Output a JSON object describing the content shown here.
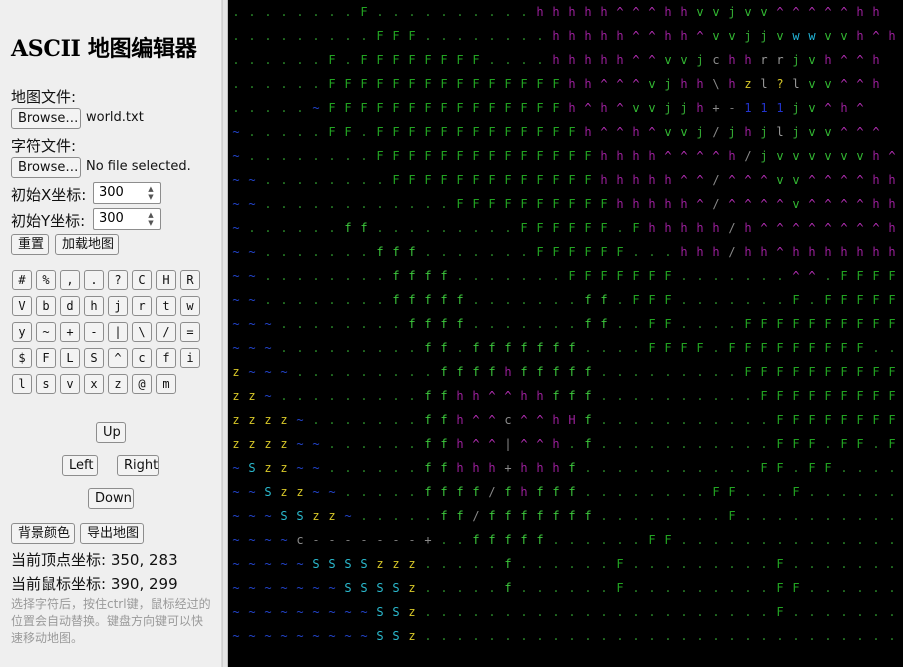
{
  "sidebar": {
    "title": "ASCII 地图编辑器",
    "map_file_label": "地图文件:",
    "map_browse": "Browse…",
    "map_file_name": "world.txt",
    "char_file_label": "字符文件:",
    "char_browse": "Browse…",
    "char_file_name": "No file selected.",
    "start_x_label": "初始X坐标:",
    "start_x_value": "300",
    "start_y_label": "初始Y坐标:",
    "start_y_value": "300",
    "reset_button": "重置",
    "load_button": "加载地图",
    "char_buttons": [
      "#",
      "%",
      ",",
      ".",
      "?",
      "C",
      "H",
      "R",
      "V",
      "b",
      "d",
      "h",
      "j",
      "r",
      "t",
      "w",
      "y",
      "~",
      "+",
      "-",
      "|",
      "\\",
      "/",
      "=",
      "$",
      "F",
      "L",
      "S",
      "^",
      "c",
      "f",
      "i",
      "l",
      "s",
      "v",
      "x",
      "z",
      "@",
      "m"
    ],
    "nav": {
      "up": "Up",
      "left": "Left",
      "right": "Right",
      "down": "Down"
    },
    "bg_color_button": "背景颜色",
    "export_button": "导出地图",
    "vertex_label": "当前顶点坐标: 350, 283",
    "mouse_label": "当前鼠标坐标: 390, 299",
    "hint": "选择字符后，按住ctrl键，鼠标经过的位置会自动替换。键盘方向键可以快速移动地图。"
  },
  "map": {
    "background": "#000000",
    "colors": {
      ".": "#2a8a2a",
      "F": "#22a522",
      "f": "#3cc83c",
      "h": "#9a1f9a",
      "^": "#b42eb4",
      "v": "#33bb33",
      "j": "#33aa33",
      "w": "#22b5d8",
      "c": "#8a8a8a",
      "z": "#d8c828",
      "S": "#2ab8cc",
      "~": "#2244cc",
      "-": "#777777",
      "+": "#8a8a8a",
      "/": "#8a8a8a",
      "\\": "#8a8a8a",
      "|": "#8a8a8a",
      "1": "#2233cc",
      "2": "#d8c828",
      "?": "#d8c828",
      "r": "#9a9a9a",
      "H": "#9a1f9a",
      "l": "#9a9a9a"
    },
    "rows": [
      ". . . . . . . . F . . . . . . . . . . h h h h h ^ ^ ^ h h v v j v v ^ ^ ^ ^ ^ h h",
      ". . . . . . . . . F F F . . . . . . . . h h h h h ^ ^ h h ^ v v j j v w w v v h ^ h",
      ". . . . . . F . F F F F F F F F . . . . h h h h h ^ ^ v v j c h h r r j v h ^ ^ h",
      ". . . . . . F F F F F F F F F F F F F F F h h ^ ^ ^ v j h h \\ h z l ? l v v ^ ^ h",
      ". . . . . ~ F F F F F F F F F F F F F F F h ^ h ^ v v j j h + - 1 1 1 j v ^ h ^",
      "~ . . . . . F F . F F F F F F F F F F F F F h ^ ^ h ^ v v j / j h j l j v v ^ ^ ^",
      "~ . . . . . . . . F F F F F F F F F F F F F F h h h h ^ ^ ^ ^ h / j v v v v v v h ^ ^ ^",
      "~ ~ . . . . . . . . F F F F F F F F F F F F F h h h h h ^ ^ / ^ ^ ^ v v ^ ^ ^ ^ h h",
      "~ ~ . . . . . . . . . . . . F F F F F F F F F F h h h h h ^ / ^ ^ ^ ^ v ^ ^ ^ ^ h h",
      "~ . . . . . . f f . . . . . . . . . F F F F F F . F h h h h h / h ^ ^ ^ ^ ^ ^ ^ ^ h h h h h",
      "~ ~ . . . . . . . f f f . . . . . . . F F F F F F . . . h h h / h h ^ h h h h h h h h ^ h h h",
      "~ ~ . . . . . . . . f f f f . . . . . . . F F F F F F F . . . . . . . ^ ^ . F F F F F F F F F F",
      "~ ~ . . . . . . . . f f f f f . . . . . . . f f . F F F . . . . . . . F . F F F F F F F F F F F F",
      "~ ~ ~ . . . . . . . . f f f f . . . . . . . f f . . F F . . . . F F F F F F F F F F F F . . . .",
      "~ ~ ~ . . . . . . . . . f f . f f f f f f f . . . . F F F F . F F F F F F F F F . . . . .",
      "z ~ ~ ~ . . . . . . . . . f f f f h f f f f f . . . . . . . . . F F F F F F F F F F F . . . . .",
      "z z ~ . . . . . . . . . f f h h ^ ^ h h f f f . . . . . . . . . . F F F F F F F F F F . . . . .",
      "z z z z ~ . . . . . . . f f h ^ ^ c ^ ^ h H f . . . . . . . . . . . F F F F F F F F . . . . . .",
      "z z z z ~ ~ . . . . . . f f h ^ ^ | ^ ^ h . f . . . . . . . . . . . F F F . F F . F F F F . . . .",
      "~ S z z ~ ~ . . . . . . f f h h h + h h h f . . . . . . . . . . . F F . F F . . . . . . . . . .",
      "~ ~ S z z ~ ~ . . . . . f f f f / f h f f f . . . . . . . . F F . . . F . . . . . . . . . . . .",
      "~ ~ ~ S S z z ~ . . . . . f f / f f f f f f f . . . . . . . . F . . . . . . . . . . . . . . .",
      "~ ~ ~ ~ c - - - - - - - + . . f f f f f . . . . . . F F . . . . . . . . . . . . . . . . . . .",
      "~ ~ ~ ~ ~ S S S S z z z . . . . . f . . . . . . F . . . . . . . . . F . . . . . . . . . . . .",
      "~ ~ ~ ~ ~ ~ ~ S S S S z . . . . . f . . . . . . F . . . . . . . . . F F . . . . . . . . . . .",
      "~ ~ ~ ~ ~ ~ ~ ~ ~ S S z . . . . . . . . . . . . . . . . . . . . . . F . . . . . . . . . . .",
      "~ ~ ~ ~ ~ ~ ~ ~ ~ S S z . . . . . . . . . . . . . . . . . . . . . . . . . . . . . . . . . ."
    ]
  }
}
